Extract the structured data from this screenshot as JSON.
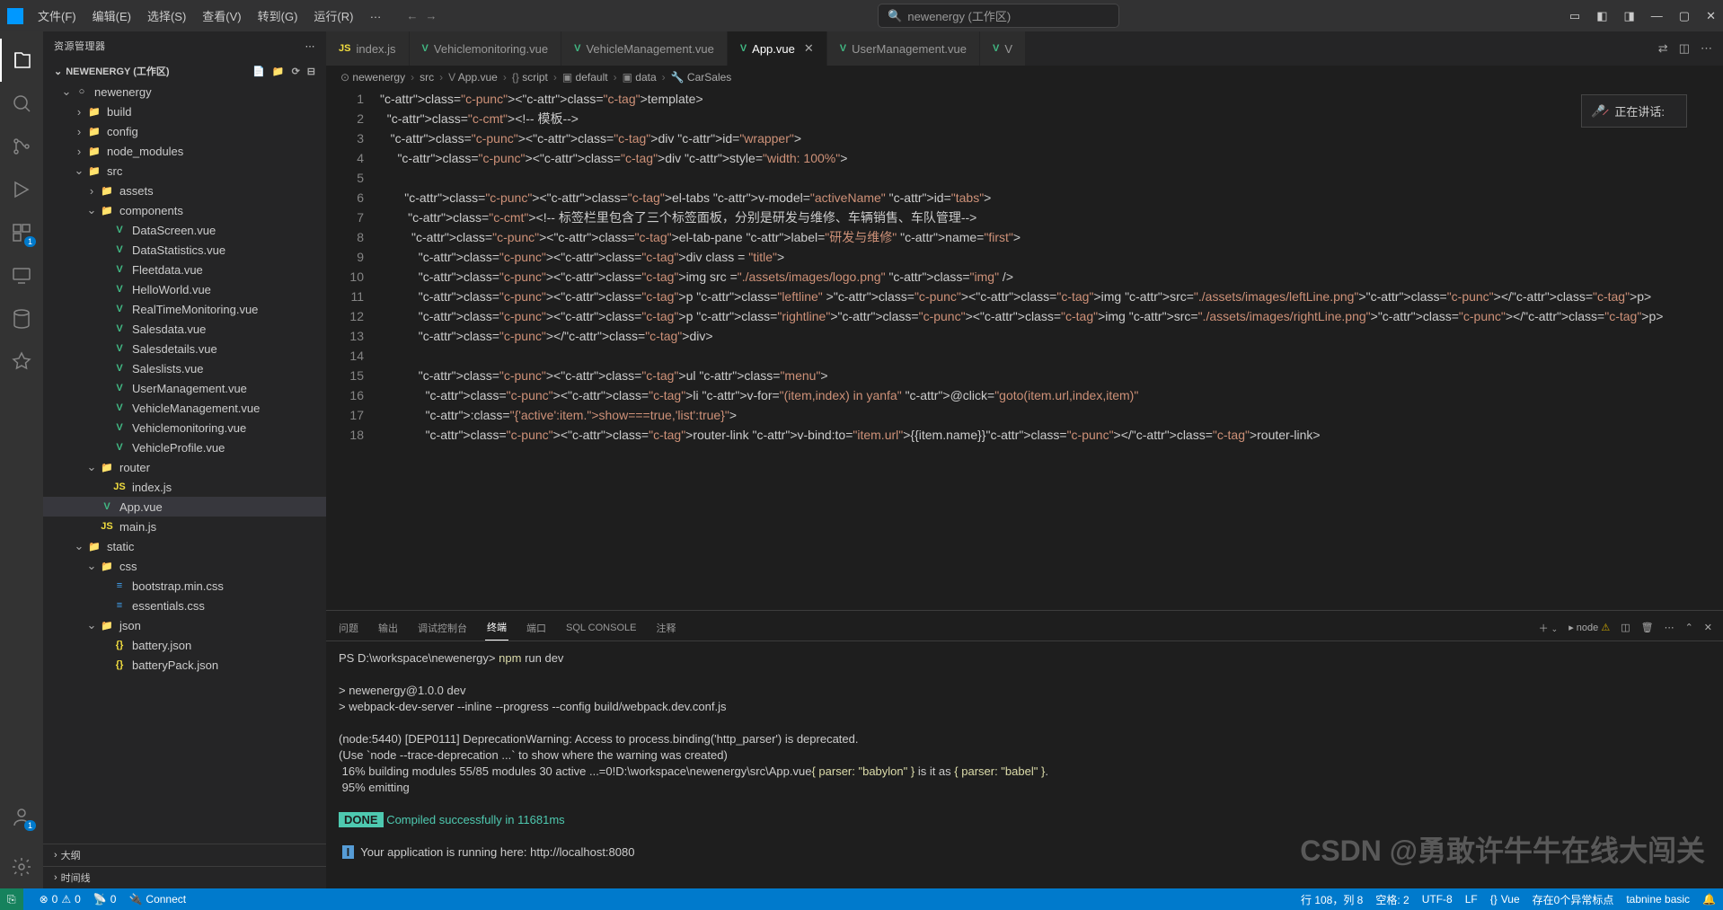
{
  "titlebar": {
    "menus": [
      "文件(F)",
      "编辑(E)",
      "选择(S)",
      "查看(V)",
      "转到(G)",
      "运行(R)",
      "…"
    ],
    "search_placeholder": "newenergy (工作区)",
    "toast": "正在讲话:"
  },
  "sidebar": {
    "title": "资源管理器",
    "folder_title": "NEWENERGY (工作区)",
    "tree": [
      {
        "depth": 0,
        "chev": "v",
        "icon": "folder-root",
        "label": "newenergy",
        "color": "#ccc"
      },
      {
        "depth": 1,
        "chev": ">",
        "icon": "folder",
        "label": "build",
        "color": "#ccc"
      },
      {
        "depth": 1,
        "chev": ">",
        "icon": "folder",
        "label": "config",
        "color": "#ccc"
      },
      {
        "depth": 1,
        "chev": ">",
        "icon": "folder",
        "label": "node_modules",
        "color": "#ccc"
      },
      {
        "depth": 1,
        "chev": "v",
        "icon": "folder-src",
        "label": "src",
        "color": "#ccc"
      },
      {
        "depth": 2,
        "chev": ">",
        "icon": "folder-assets",
        "label": "assets",
        "color": "#ccc"
      },
      {
        "depth": 2,
        "chev": "v",
        "icon": "folder-comp",
        "label": "components",
        "color": "#ccc"
      },
      {
        "depth": 3,
        "chev": "",
        "icon": "vue",
        "label": "DataScreen.vue",
        "color": "#ccc"
      },
      {
        "depth": 3,
        "chev": "",
        "icon": "vue",
        "label": "DataStatistics.vue",
        "color": "#ccc"
      },
      {
        "depth": 3,
        "chev": "",
        "icon": "vue",
        "label": "Fleetdata.vue",
        "color": "#ccc"
      },
      {
        "depth": 3,
        "chev": "",
        "icon": "vue",
        "label": "HelloWorld.vue",
        "color": "#ccc"
      },
      {
        "depth": 3,
        "chev": "",
        "icon": "vue",
        "label": "RealTimeMonitoring.vue",
        "color": "#ccc"
      },
      {
        "depth": 3,
        "chev": "",
        "icon": "vue",
        "label": "Salesdata.vue",
        "color": "#ccc"
      },
      {
        "depth": 3,
        "chev": "",
        "icon": "vue",
        "label": "Salesdetails.vue",
        "color": "#ccc"
      },
      {
        "depth": 3,
        "chev": "",
        "icon": "vue",
        "label": "Saleslists.vue",
        "color": "#ccc"
      },
      {
        "depth": 3,
        "chev": "",
        "icon": "vue",
        "label": "UserManagement.vue",
        "color": "#ccc"
      },
      {
        "depth": 3,
        "chev": "",
        "icon": "vue",
        "label": "VehicleManagement.vue",
        "color": "#ccc"
      },
      {
        "depth": 3,
        "chev": "",
        "icon": "vue",
        "label": "Vehiclemonitoring.vue",
        "color": "#ccc"
      },
      {
        "depth": 3,
        "chev": "",
        "icon": "vue",
        "label": "VehicleProfile.vue",
        "color": "#ccc"
      },
      {
        "depth": 2,
        "chev": "v",
        "icon": "folder-router",
        "label": "router",
        "color": "#ccc"
      },
      {
        "depth": 3,
        "chev": "",
        "icon": "js",
        "label": "index.js",
        "color": "#ccc"
      },
      {
        "depth": 2,
        "chev": "",
        "icon": "vue",
        "label": "App.vue",
        "color": "#ccc",
        "active": true
      },
      {
        "depth": 2,
        "chev": "",
        "icon": "js",
        "label": "main.js",
        "color": "#ccc"
      },
      {
        "depth": 1,
        "chev": "v",
        "icon": "folder",
        "label": "static",
        "color": "#ccc"
      },
      {
        "depth": 2,
        "chev": "v",
        "icon": "folder-css",
        "label": "css",
        "color": "#ccc"
      },
      {
        "depth": 3,
        "chev": "",
        "icon": "css",
        "label": "bootstrap.min.css",
        "color": "#ccc"
      },
      {
        "depth": 3,
        "chev": "",
        "icon": "css",
        "label": "essentials.css",
        "color": "#ccc"
      },
      {
        "depth": 2,
        "chev": "v",
        "icon": "folder-json",
        "label": "json",
        "color": "#ccc"
      },
      {
        "depth": 3,
        "chev": "",
        "icon": "json",
        "label": "battery.json",
        "color": "#ccc"
      },
      {
        "depth": 3,
        "chev": "",
        "icon": "json",
        "label": "batteryPack.json",
        "color": "#ccc"
      }
    ],
    "outline": "大纲",
    "timeline": "时间线"
  },
  "tabs": [
    {
      "icon": "js",
      "label": "index.js",
      "active": false
    },
    {
      "icon": "vue",
      "label": "Vehiclemonitoring.vue",
      "active": false
    },
    {
      "icon": "vue",
      "label": "VehicleManagement.vue",
      "active": false
    },
    {
      "icon": "vue",
      "label": "App.vue",
      "active": true,
      "close": true
    },
    {
      "icon": "vue",
      "label": "UserManagement.vue",
      "active": false
    },
    {
      "icon": "vue",
      "label": "V",
      "active": false
    }
  ],
  "breadcrumb": [
    "newenergy",
    "src",
    "App.vue",
    "script",
    "default",
    "data",
    "CarSales"
  ],
  "code": {
    "start_line": 1,
    "lines": [
      "<template>",
      "  <!-- 模板-->",
      "   <div id=\"wrapper\">",
      "     <div style=\"width: 100%\">",
      "",
      "       <el-tabs v-model=\"activeName\" id=\"tabs\">",
      "        <!-- 标签栏里包含了三个标签面板，分别是研发与维修、车辆销售、车队管理-->",
      "         <el-tab-pane label=\"研发与维修\" name=\"first\">",
      "           <div class = \"title\">",
      "           <img src =\"./assets/images/logo.png\" class=\"img\" />",
      "           <p class=\"leftline\" ><img src=\"./assets/images/leftLine.png\"></p>",
      "           <p class=\"rightline\"><img src=\"./assets/images/rightLine.png\"></p>",
      "           </div>",
      "",
      "           <ul class=\"menu\">",
      "             <li v-for=\"(item,index) in yanfa\" @click=\"goto(item.url,index,item)\"",
      "             :class=\"{'active':item.show===true,'list':true}\">",
      "             <router-link v-bind:to=\"item.url\">{{item.name}}</router-link>"
    ]
  },
  "panel": {
    "tabs": [
      "问题",
      "输出",
      "调试控制台",
      "终端",
      "端口",
      "SQL CONSOLE",
      "注释"
    ],
    "active_tab": "终端",
    "terminal_label": "node",
    "terminal": {
      "prompt": "PS D:\\workspace\\newenergy>",
      "cmd": "npm run dev",
      "lines": [
        "",
        "> newenergy@1.0.0 dev",
        "> webpack-dev-server --inline --progress --config build/webpack.dev.conf.js",
        "",
        "(node:5440) [DEP0111] DeprecationWarning: Access to process.binding('http_parser') is deprecated.",
        "(Use `node --trace-deprecation ...` to show where the warning was created)",
        " 16% building modules 55/85 modules 30 active ...=0!D:\\workspace\\newenergy\\src\\App.vue{ parser: \"babylon\" } is it as { parser: \"babel\" }.",
        " 95% emitting"
      ],
      "done": "DONE",
      "done_msg": "Compiled successfully in 11681ms",
      "info": "I",
      "info_msg": "Your application is running here: http://localhost:8080"
    }
  },
  "statusbar": {
    "errors": "0",
    "warnings": "0",
    "port": "0",
    "connect": "Connect",
    "ln_col": "行 108，列 8",
    "spaces": "空格: 2",
    "encoding": "UTF-8",
    "eol": "LF",
    "lang": "Vue",
    "diag": "存在0个异常标点",
    "tabnine": "tabnine basic"
  },
  "watermark": "CSDN @勇敢许牛牛在线大闯关"
}
